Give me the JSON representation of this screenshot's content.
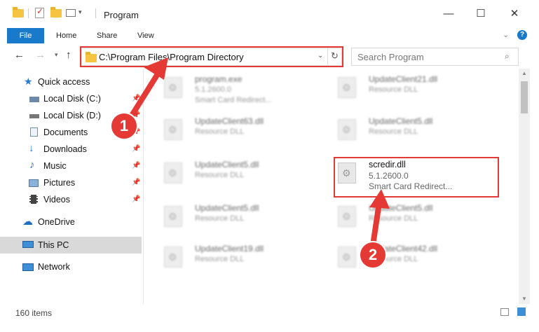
{
  "window": {
    "title": "Program"
  },
  "titlebar_buttons": {
    "minimize": "—",
    "maximize": "☐",
    "close": "✕"
  },
  "ribbon": {
    "file": "File",
    "tabs": [
      "Home",
      "Share",
      "View"
    ]
  },
  "address": {
    "path": "C:\\Program Files\\Program Directory",
    "refresh_icon": "refresh-icon"
  },
  "search": {
    "placeholder": "Search Program"
  },
  "nav": {
    "quick_access": "Quick access",
    "items": [
      {
        "label": "Local Disk (C:)",
        "pinned": true
      },
      {
        "label": "Local Disk (D:)",
        "pinned": true
      },
      {
        "label": "Documents",
        "pinned": true
      },
      {
        "label": "Downloads",
        "pinned": true
      },
      {
        "label": "Music",
        "pinned": true
      },
      {
        "label": "Pictures",
        "pinned": true
      },
      {
        "label": "Videos",
        "pinned": true
      }
    ],
    "onedrive": "OneDrive",
    "this_pc": "This PC",
    "network": "Network"
  },
  "files": [
    {
      "name": "program.exe",
      "line1": "5.1.2600.0",
      "line2": "Smart Card Redirect..."
    },
    {
      "name": "UpdateClient21.dll",
      "line1": "Resource DLL",
      "line2": ""
    },
    {
      "name": "UpdateClient63.dll",
      "line1": "Resource DLL",
      "line2": ""
    },
    {
      "name": "UpdateClient5.dll",
      "line1": "Resource DLL",
      "line2": ""
    },
    {
      "name": "UpdateClient5.dll",
      "line1": "Resource DLL",
      "line2": ""
    },
    {
      "name": "scredir.dll",
      "line1": "5.1.2600.0",
      "line2": "Smart Card Redirect..."
    },
    {
      "name": "UpdateClient5.dll",
      "line1": "Resource DLL",
      "line2": ""
    },
    {
      "name": "UpdateClient5.dll",
      "line1": "Resource DLL",
      "line2": ""
    },
    {
      "name": "UpdateClient19.dll",
      "line1": "Resource DLL",
      "line2": ""
    },
    {
      "name": "UpdateClient42.dll",
      "line1": "Resource DLL",
      "line2": ""
    }
  ],
  "status": {
    "items": "160 items"
  },
  "callouts": [
    "1",
    "2"
  ],
  "colors": {
    "accent": "#1979ca",
    "highlight": "#e53935"
  }
}
